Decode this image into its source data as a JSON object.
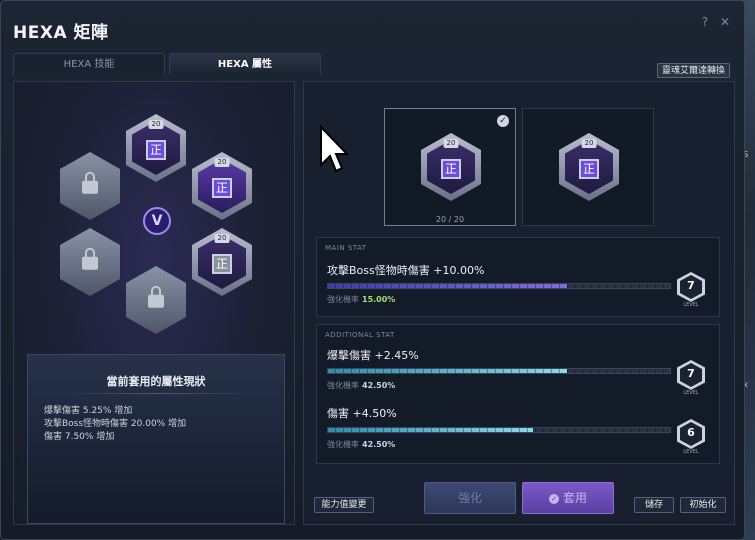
{
  "window": {
    "title": "HEXA 矩陣"
  },
  "top_icons": [
    "help-icon",
    "close-icon"
  ],
  "tabs": [
    {
      "label": "HEXA 技能",
      "active": false
    },
    {
      "label": "HEXA 屬性",
      "active": true
    }
  ],
  "top_right_button": "靈魂艾爾達轉換",
  "matrix": {
    "center_label": "V",
    "nodes": [
      {
        "pos": "top",
        "state": "stat",
        "level": "20",
        "glyph": "正"
      },
      {
        "pos": "upper-left",
        "state": "locked"
      },
      {
        "pos": "upper-right",
        "state": "stat",
        "level": "20",
        "glyph": "正",
        "glow": true
      },
      {
        "pos": "lower-left",
        "state": "locked"
      },
      {
        "pos": "lower-right",
        "state": "stat",
        "level": "20",
        "glyph": "正",
        "silver": true
      },
      {
        "pos": "bottom",
        "state": "locked"
      }
    ]
  },
  "status": {
    "title": "當前套用的屬性現狀",
    "lines": [
      "爆擊傷害 5.25% 增加",
      "攻擊Boss怪物時傷害 20.00% 增加",
      "傷害 7.50% 增加"
    ]
  },
  "cores": [
    {
      "level": "20",
      "glyph": "正",
      "selected": true,
      "count": "20 / 20"
    },
    {
      "level": "20",
      "glyph": "正",
      "selected": false
    }
  ],
  "main_stat": {
    "header": "MAIN STAT",
    "name": "攻擊Boss怪物時傷害 +10.00%",
    "progress": 0.7,
    "rate_label": "強化機率",
    "rate": "15.00%",
    "level": "7",
    "level_caption": "LEVEL"
  },
  "additional_stat": {
    "header": "ADDITIONAL STAT",
    "items": [
      {
        "name": "爆擊傷害 +2.45%",
        "progress": 0.7,
        "rate_label": "強化機率",
        "rate": "42.50%",
        "level": "7",
        "level_caption": "LEVEL"
      },
      {
        "name": "傷害 +4.50%",
        "progress": 0.6,
        "rate_label": "強化機率",
        "rate": "42.50%",
        "level": "6",
        "level_caption": "LEVEL"
      }
    ]
  },
  "buttons": {
    "change": "能力值變更",
    "enhance": "強化",
    "apply": "套用",
    "save": "儲存",
    "reset": "初始化"
  },
  "edge_labels": [
    "1S",
    "1",
    "0x",
    "C"
  ]
}
